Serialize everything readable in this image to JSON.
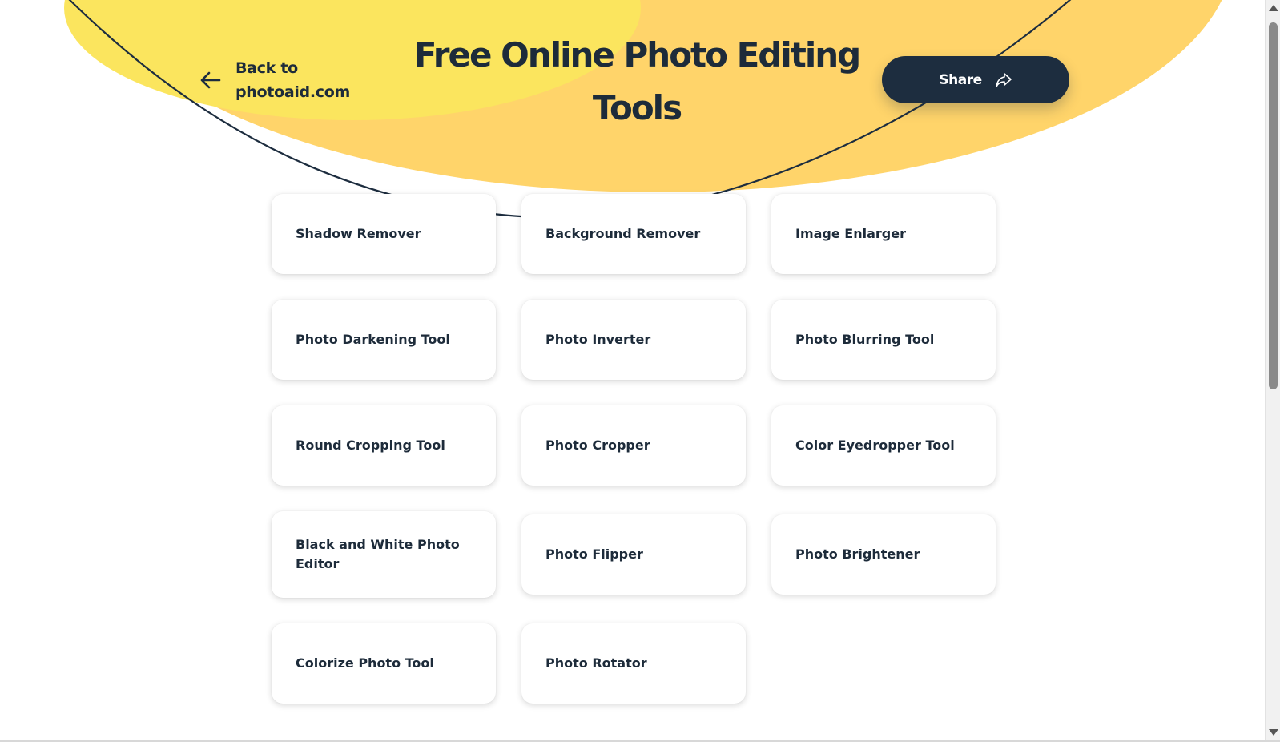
{
  "header": {
    "back_link_line1": "Back to",
    "back_link_line2": "photoaid.com",
    "title_line1": "Free Online Photo Editing",
    "title_line2": "Tools",
    "share_label": "Share"
  },
  "icons": {
    "back": "arrow-left-icon",
    "share": "share-arrow-icon"
  },
  "tools": [
    {
      "label": "Shadow Remover"
    },
    {
      "label": "Background Remover"
    },
    {
      "label": "Image Enlarger"
    },
    {
      "label": "Photo Darkening Tool"
    },
    {
      "label": "Photo Inverter"
    },
    {
      "label": "Photo Blurring Tool"
    },
    {
      "label": "Round Cropping Tool"
    },
    {
      "label": "Photo Cropper"
    },
    {
      "label": "Color Eyedropper Tool"
    },
    {
      "label": "Black and White Photo Editor"
    },
    {
      "label": "Photo Flipper"
    },
    {
      "label": "Photo Brightener"
    },
    {
      "label": "Colorize Photo Tool"
    },
    {
      "label": "Photo Rotator"
    }
  ],
  "colors": {
    "hero_yellow": "#ffd46a",
    "hero_light_yellow": "#fbe55e",
    "navy": "#1d2d3f",
    "card_bg": "#ffffff",
    "page_bg": "#ffffff"
  }
}
